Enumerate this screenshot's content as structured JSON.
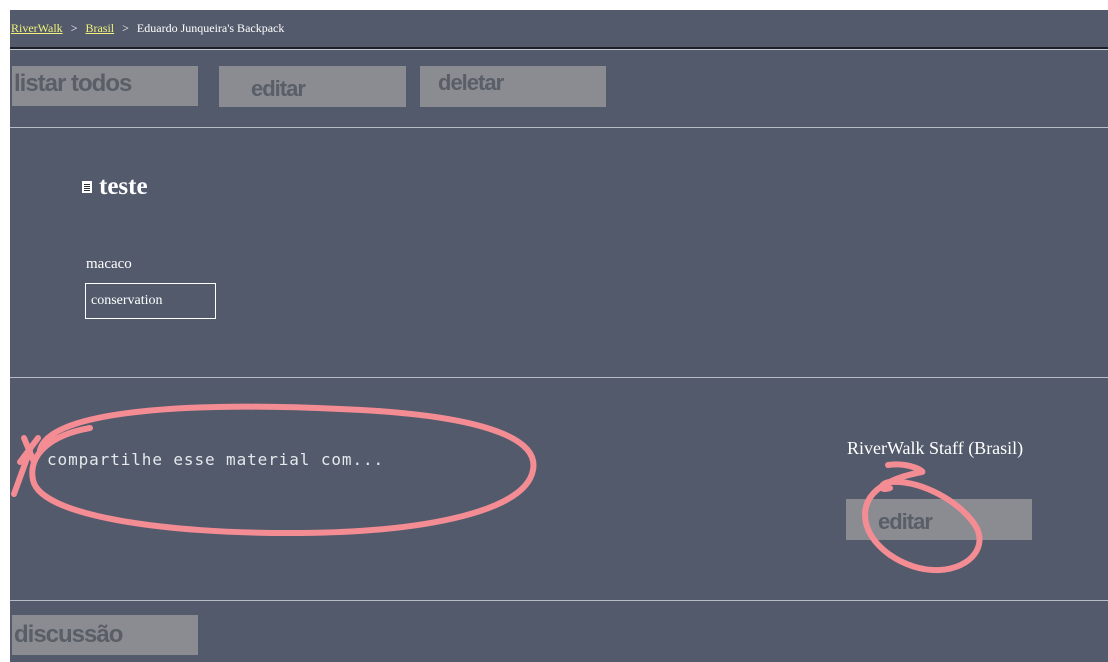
{
  "breadcrumb": {
    "link1": "RiverWalk",
    "sep1": ">",
    "link2": "Brasil",
    "sep2": ">",
    "current": "Eduardo Junqueira's Backpack"
  },
  "toolbar": {
    "list_all": "listar todos",
    "edit": "editar",
    "delete": "deletar"
  },
  "item": {
    "title": "teste",
    "tag_label": "macaco",
    "tag": "conservation"
  },
  "share": {
    "text": "compartilhe esse material com...",
    "staff": "RiverWalk Staff (Brasil)",
    "edit": "editar"
  },
  "footer": {
    "discussion": "discussão"
  },
  "colors": {
    "background": "#525a6b",
    "link": "#f2f27a",
    "button": "#8a8c92",
    "annotation": "#f48c94"
  },
  "icons": {
    "title_icon": "document-icon"
  }
}
